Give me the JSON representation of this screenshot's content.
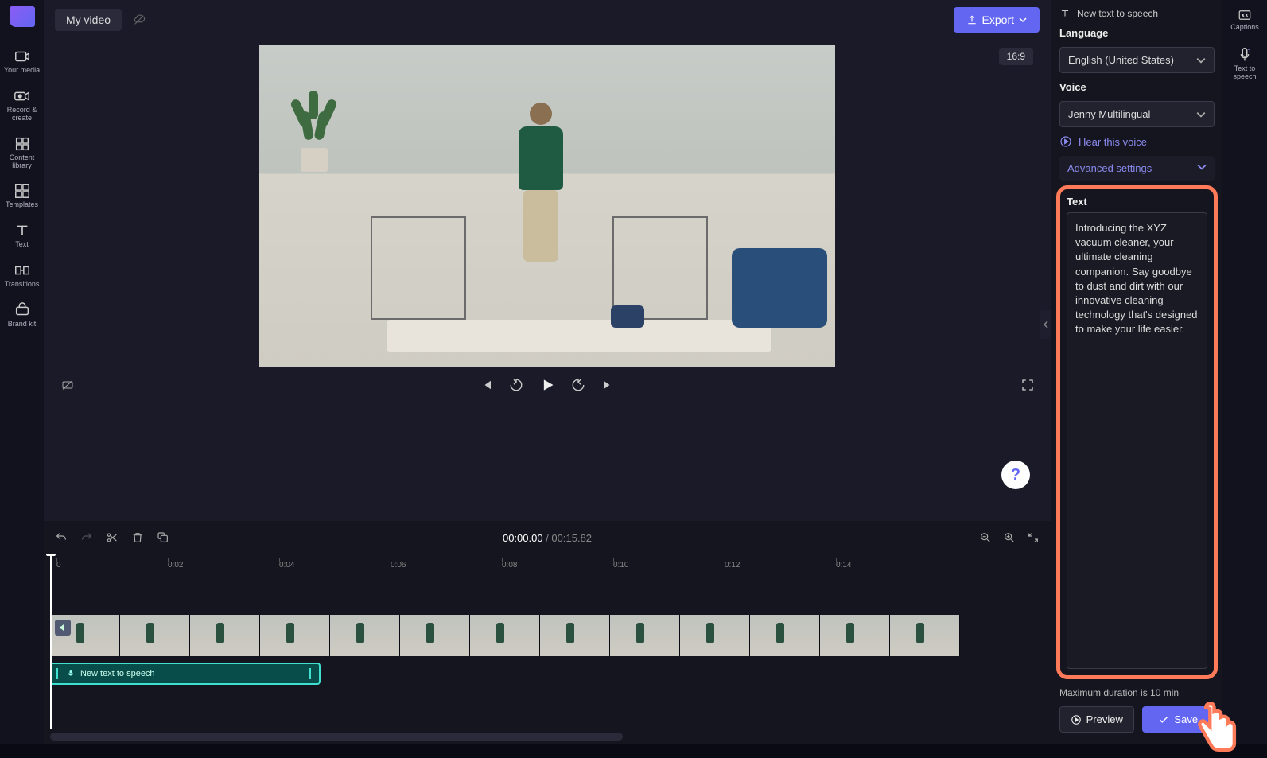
{
  "app": {
    "title": "My video",
    "aspect_ratio": "16:9"
  },
  "export": {
    "label": "Export"
  },
  "left_nav": {
    "items": [
      {
        "label": "Your media"
      },
      {
        "label": "Record & create"
      },
      {
        "label": "Content library"
      },
      {
        "label": "Templates"
      },
      {
        "label": "Text"
      },
      {
        "label": "Transitions"
      },
      {
        "label": "Brand kit"
      }
    ]
  },
  "player": {
    "time_current": "00:00.00",
    "time_total": "00:15.82"
  },
  "ruler": {
    "marks": [
      "0",
      "0:02",
      "0:04",
      "0:06",
      "0:08",
      "0:10",
      "0:12",
      "0:14"
    ]
  },
  "timeline": {
    "tts_clip_label": "New text to speech"
  },
  "tts_panel": {
    "header": "New text to speech",
    "language_label": "Language",
    "language_value": "English (United States)",
    "voice_label": "Voice",
    "voice_value": "Jenny Multilingual",
    "hear_voice": "Hear this voice",
    "advanced": "Advanced settings",
    "text_label": "Text",
    "text_value": "Introducing the XYZ vacuum cleaner, your ultimate cleaning companion. Say goodbye to dust and dirt with our innovative cleaning technology that's designed to make your life easier.",
    "max_duration": "Maximum duration is 10 min",
    "preview": "Preview",
    "save": "Save"
  },
  "right_rail": {
    "captions": "Captions",
    "tts": "Text to speech"
  },
  "help": "?"
}
